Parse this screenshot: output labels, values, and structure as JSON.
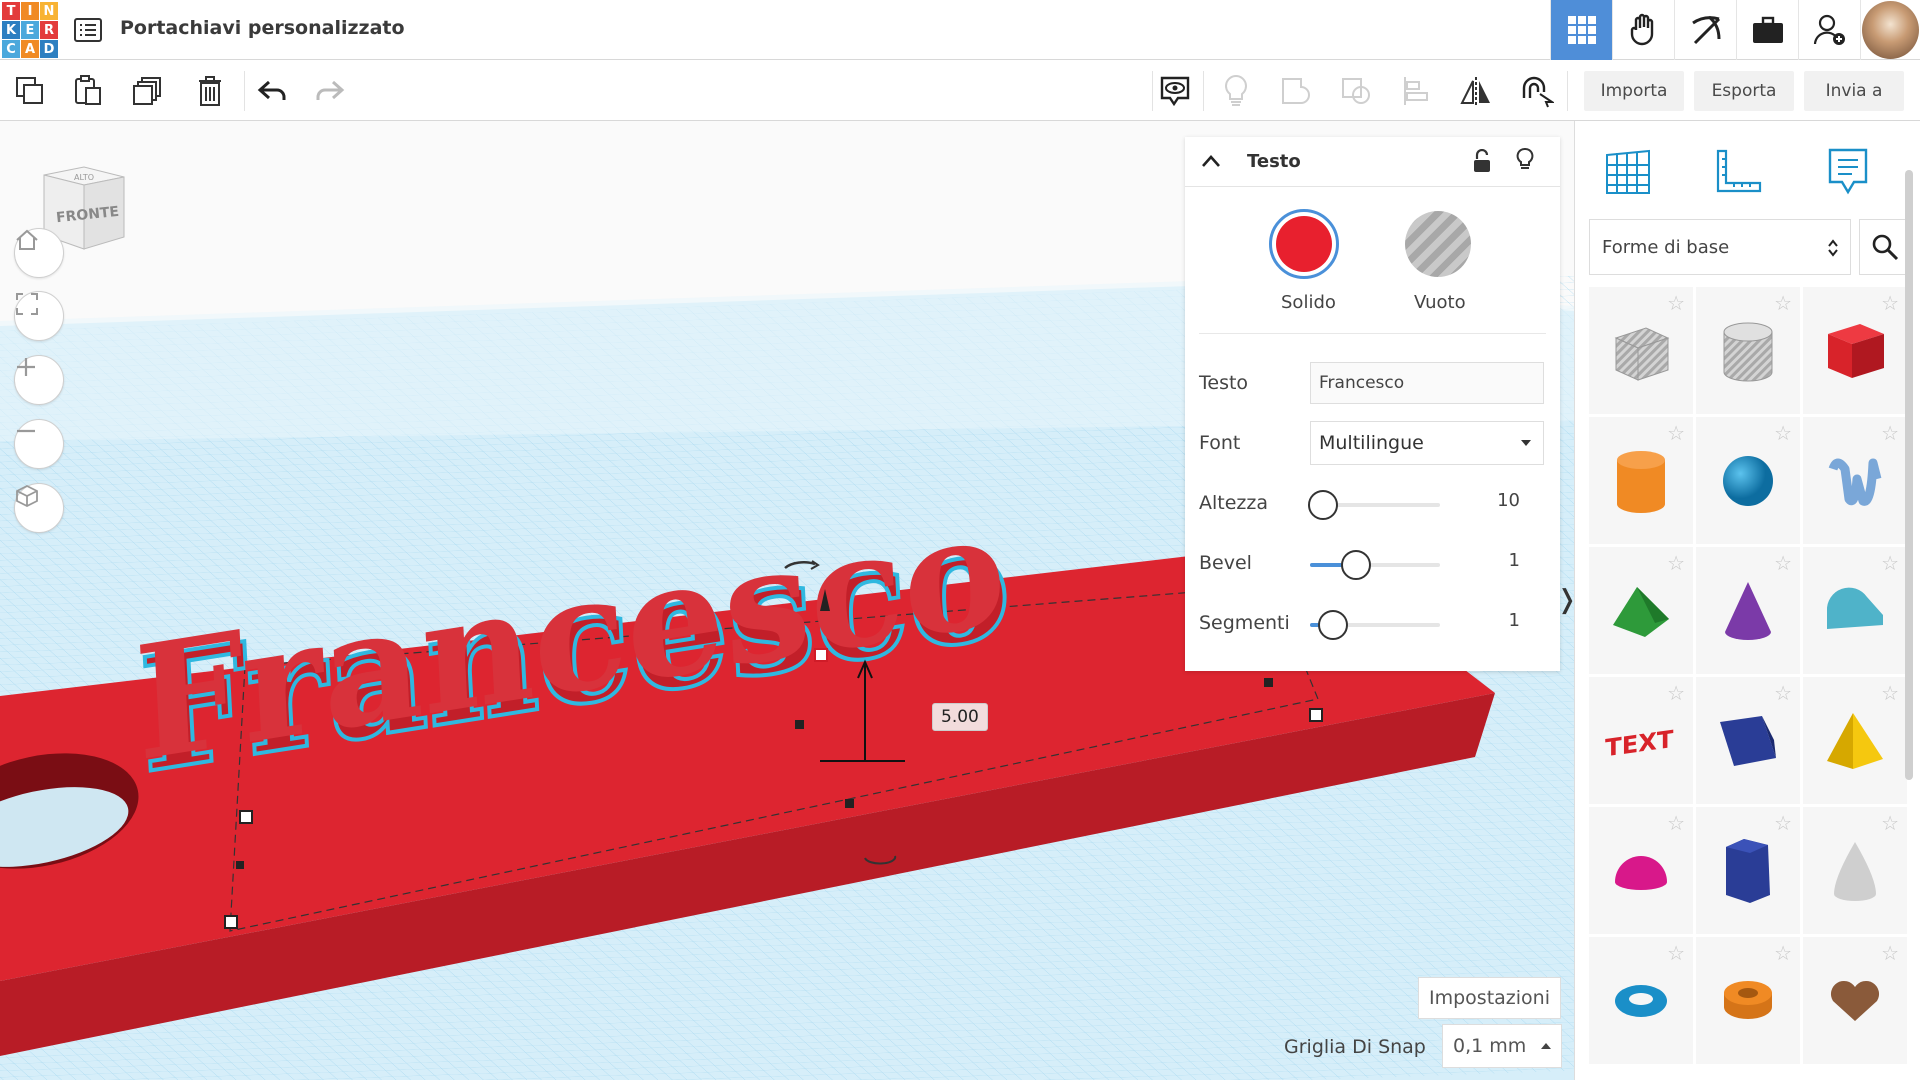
{
  "app": {
    "logo_letters": [
      "T",
      "I",
      "N",
      "K",
      "E",
      "R",
      "C",
      "A",
      "D"
    ],
    "logo_colors": [
      "#e33b3b",
      "#f08a24",
      "#f8b333",
      "#2d7fc1",
      "#4ba8dc",
      "#e33b3b",
      "#4ba8dc",
      "#f08a24",
      "#2d7fc1"
    ],
    "document_title": "Portachiavi personalizzato"
  },
  "topbar": {
    "buttons": [
      "grid-view-icon",
      "hand-icon",
      "pickaxe-icon",
      "briefcase-icon",
      "add-user-icon"
    ]
  },
  "toolbar": {
    "import_label": "Importa",
    "export_label": "Esporta",
    "send_label": "Invia a"
  },
  "viewport": {
    "navcube_top": "ALTO",
    "navcube_front": "FRONTE",
    "dimension_value": "5.00",
    "model_text": "Francesco",
    "settings_label": "Impostazioni",
    "snap_label": "Griglia Di Snap",
    "snap_value": "0,1 mm"
  },
  "inspector": {
    "title": "Testo",
    "solid_label": "Solido",
    "hole_label": "Vuoto",
    "solid_color": "#e8202e",
    "fields": {
      "text_label": "Testo",
      "text_value": "Francesco",
      "font_label": "Font",
      "font_value": "Multilingue",
      "height_label": "Altezza",
      "height_value": "10",
      "height_fraction": 0.1,
      "bevel_label": "Bevel",
      "bevel_value": "1",
      "bevel_fraction": 0.35,
      "segments_label": "Segmenti",
      "segments_value": "1",
      "segments_fraction": 0.18
    }
  },
  "sidebar": {
    "tabs": [
      "grid-icon",
      "ruler-icon",
      "notes-icon"
    ],
    "category": "Forme di base",
    "shapes": [
      {
        "name": "box-hole",
        "color": "#b8b8b8"
      },
      {
        "name": "cylinder-hole",
        "color": "#c4c4c4"
      },
      {
        "name": "box",
        "color": "#d8232a"
      },
      {
        "name": "cylinder",
        "color": "#f08a24"
      },
      {
        "name": "sphere",
        "color": "#1a8fc8"
      },
      {
        "name": "scribble",
        "color": "#7aa7d8"
      },
      {
        "name": "roof",
        "color": "#2e9a3a"
      },
      {
        "name": "cone",
        "color": "#7b3aa8"
      },
      {
        "name": "round-roof",
        "color": "#4fb3c9"
      },
      {
        "name": "text",
        "color": "#d8232a"
      },
      {
        "name": "wedge",
        "color": "#2a3d96"
      },
      {
        "name": "pyramid",
        "color": "#f5c80f"
      },
      {
        "name": "half-sphere",
        "color": "#d8188a"
      },
      {
        "name": "polygon",
        "color": "#2a3d96"
      },
      {
        "name": "paraboloid",
        "color": "#cfcfcf"
      },
      {
        "name": "torus",
        "color": "#1a8fc8"
      },
      {
        "name": "tube",
        "color": "#f08a24"
      },
      {
        "name": "heart",
        "color": "#8a5a3a"
      }
    ]
  }
}
